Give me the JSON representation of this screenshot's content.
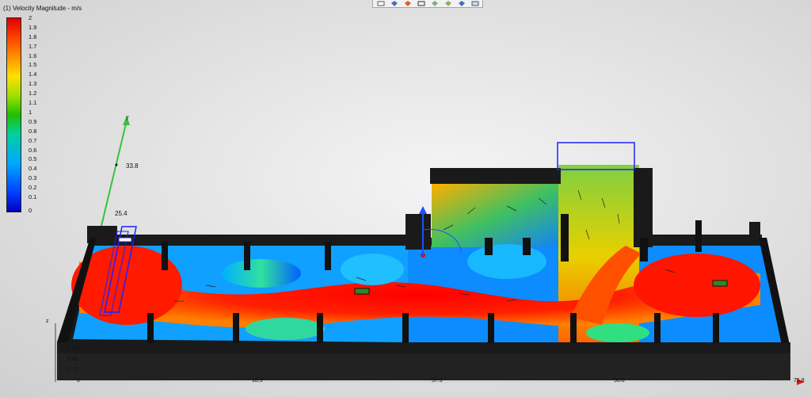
{
  "legend": {
    "title": "(1) Velocity Magnitude - m/s",
    "ticks": [
      "2",
      "1.9",
      "1.8",
      "1.7",
      "1.6",
      "1.5",
      "1.4",
      "1.3",
      "1.2",
      "1.1",
      "1",
      "0.9",
      "0.8",
      "0.7",
      "0.6",
      "0.5",
      "0.4",
      "0.3",
      "0.2",
      "0.1",
      "0"
    ]
  },
  "axes": {
    "y_label": "y",
    "y_ticks": [
      "33.8",
      "25.4"
    ],
    "x_ticks": [
      "0",
      "18.9",
      "37.9",
      "56.8",
      "75.8"
    ],
    "z_label": "z",
    "z_ticks": [
      "5.13",
      "3.42",
      "1.71"
    ]
  },
  "toolbar": {
    "icons": [
      "view-front-icon",
      "view-iso-icon",
      "shading-icon",
      "wireframe-icon",
      "section-icon",
      "display-icon",
      "arrow-icon",
      "settings-icon"
    ]
  },
  "colors": {
    "velocity_high": "#ff0000",
    "velocity_mid": "#20c000",
    "velocity_low": "#0030ff",
    "walls": "#1a1a1a",
    "outline": "#2020ff"
  }
}
